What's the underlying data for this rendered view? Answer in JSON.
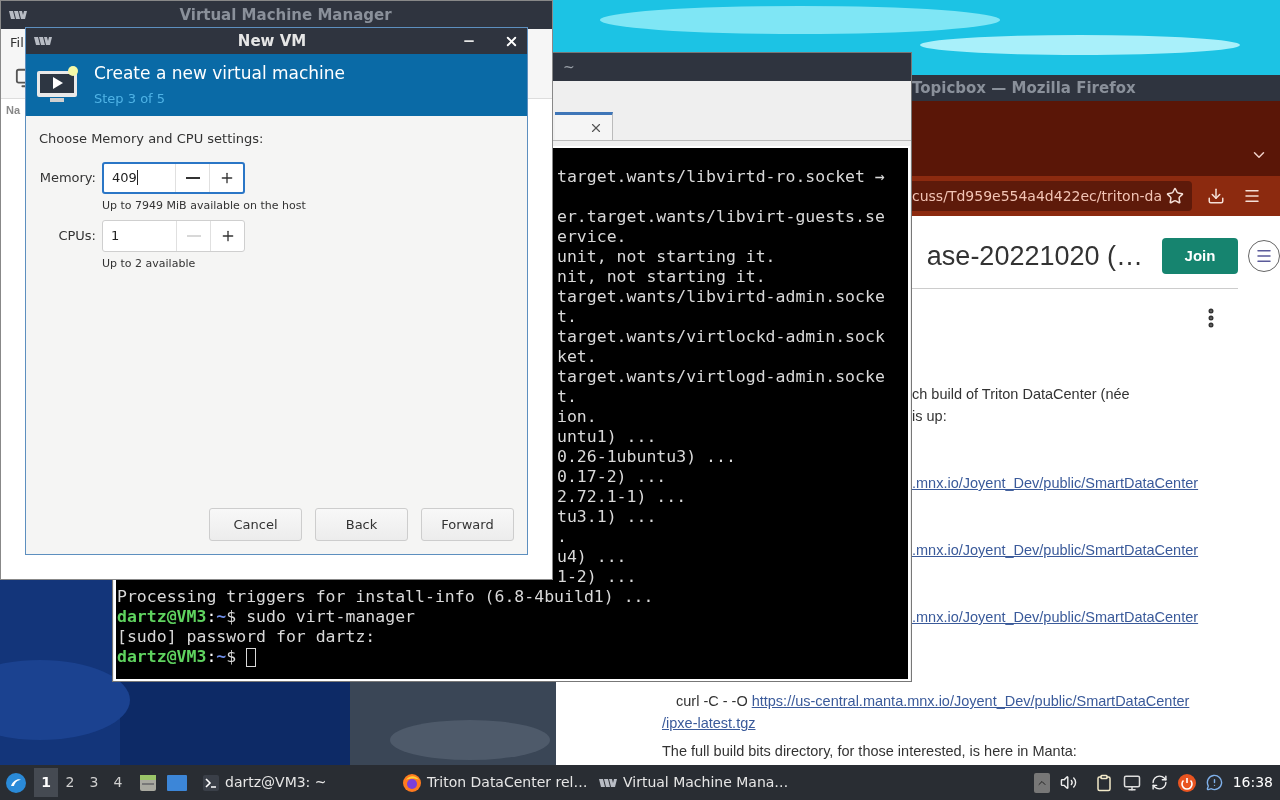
{
  "vmm_window": {
    "title": "Virtual Machine Manager",
    "menu_fragment": "Fil",
    "column_fragment": "Na"
  },
  "new_vm_dialog": {
    "title": "New VM",
    "header": {
      "title": "Create a new virtual machine",
      "step": "Step 3 of 5"
    },
    "prompt": "Choose Memory and CPU settings:",
    "fields": [
      {
        "label": "Memory:",
        "value": "409",
        "focused": true,
        "minus_disabled": false,
        "hint": "Up to 7949 MiB available on the host"
      },
      {
        "label": "CPUs:",
        "value": "1",
        "focused": false,
        "minus_disabled": true,
        "hint": "Up to 2 available"
      }
    ],
    "buttons": [
      "Cancel",
      "Back",
      "Forward"
    ]
  },
  "terminal": {
    "title": "~",
    "partial_lines": [
      {
        "kind": "text",
        "text": "target.wants/libvirtd-ro.socket →"
      },
      {
        "kind": "blank"
      },
      {
        "kind": "text",
        "text": "er.target.wants/libvirt-guests.se"
      },
      {
        "kind": "text",
        "text": "ervice."
      },
      {
        "kind": "text",
        "text": "unit, not starting it."
      },
      {
        "kind": "text",
        "text": "nit, not starting it."
      },
      {
        "kind": "text",
        "text": "target.wants/libvirtd-admin.socke"
      },
      {
        "kind": "text",
        "text": "t."
      },
      {
        "kind": "text",
        "text": "target.wants/virtlockd-admin.sock"
      },
      {
        "kind": "text",
        "text": "ket."
      },
      {
        "kind": "text",
        "text": "target.wants/virtlogd-admin.socke"
      },
      {
        "kind": "text",
        "text": "t."
      },
      {
        "kind": "text",
        "text": "ion."
      },
      {
        "kind": "text",
        "text": "untu1) ..."
      },
      {
        "kind": "text",
        "text": "0.26-1ubuntu3) ..."
      },
      {
        "kind": "text",
        "text": "0.17-2) ..."
      },
      {
        "kind": "text",
        "text": "2.72.1-1) ..."
      },
      {
        "kind": "text",
        "text": "tu3.1) ..."
      },
      {
        "kind": "text",
        "text": "."
      },
      {
        "kind": "text",
        "text": "u4) ..."
      },
      {
        "kind": "text",
        "text": "1-2) ..."
      }
    ],
    "lines": [
      {
        "kind": "output",
        "text": "Processing triggers for install-info (6.8-4build1) ..."
      },
      {
        "kind": "prompt",
        "user": "dartz@VM3",
        "separator": ":",
        "path": "~",
        "symbol": "$",
        "command": " sudo virt-manager"
      },
      {
        "kind": "output",
        "text": "[sudo] password for dartz:"
      },
      {
        "kind": "prompt",
        "user": "dartz@VM3",
        "separator": ":",
        "path": "~",
        "symbol": "$",
        "cursor": true
      }
    ]
  },
  "firefox": {
    "title": "Topicbox — Mozilla Firefox",
    "url": "cuss/Td959e554a4d422ec/triton-da",
    "heading": "ase-20221020 (…",
    "join_button": "Join",
    "paragraph_lines": [
      "ch build of Triton DataCenter (née",
      "is up:"
    ],
    "links": [
      ".mnx.io/Joyent_Dev/public/SmartDataCenter",
      ".mnx.io/Joyent_Dev/public/SmartDataCenter",
      ".mnx.io/Joyent_Dev/public/SmartDataCenter"
    ],
    "curl_command": "curl -C - -O",
    "curl_link": "https://us-central.manta.mnx.io/Joyent_Dev/public/SmartDataCenter",
    "curl_link_tail": "/ipxe-latest.tgz",
    "closing_line": "The full build bits directory, for those interested, is here in Manta:"
  },
  "taskbar": {
    "workspaces": [
      {
        "label": "1",
        "selected": true
      },
      {
        "label": "2",
        "selected": false
      },
      {
        "label": "3",
        "selected": false
      },
      {
        "label": "4",
        "selected": false
      }
    ],
    "tasks": [
      {
        "kind": "terminal",
        "label": "dartz@VM3: ~"
      },
      {
        "kind": "firefox",
        "label": "Triton DataCenter rel…"
      },
      {
        "kind": "vmm",
        "label": "Virtual Machine Mana…"
      }
    ],
    "clock": "16:38"
  }
}
